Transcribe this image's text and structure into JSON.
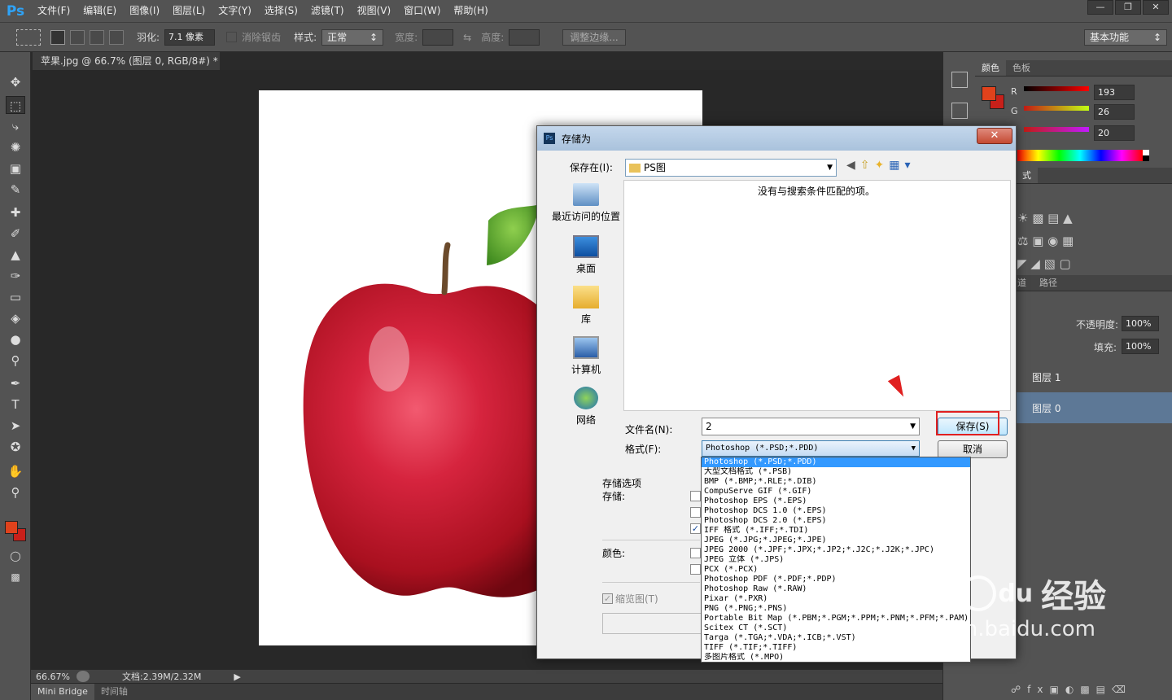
{
  "app": {
    "logo": "Ps"
  },
  "menu": [
    "文件(F)",
    "编辑(E)",
    "图像(I)",
    "图层(L)",
    "文字(Y)",
    "选择(S)",
    "滤镜(T)",
    "视图(V)",
    "窗口(W)",
    "帮助(H)"
  ],
  "options": {
    "feather_label": "羽化:",
    "feather_value": "7.1 像素",
    "antialias": "消除锯齿",
    "style_label": "样式:",
    "style_value": "正常",
    "width_label": "宽度:",
    "height_label": "高度:",
    "refine_button": "调整边缘...",
    "workspace": "基本功能"
  },
  "document": {
    "tab": "苹果.jpg @ 66.7% (图层 0, RGB/8#) *",
    "zoom": "66.67%",
    "docsize": "文档:2.39M/2.32M"
  },
  "bottom_tabs": [
    "Mini Bridge",
    "时间轴"
  ],
  "panels": {
    "color_tabs": [
      "颜色",
      "色板"
    ],
    "r_label": "R",
    "r_value": "193",
    "g_label": "G",
    "g_value": "26",
    "b_value": "20",
    "adj_tab_partial": "式",
    "layers_tabs": [
      "道",
      "路径"
    ],
    "opacity_label": "不透明度:",
    "opacity_value": "100%",
    "fill_label": "填充:",
    "fill_value": "100%",
    "layers": [
      "图层 1",
      "图层 0"
    ]
  },
  "dialog": {
    "title": "存储为",
    "savein_label": "保存在(I):",
    "savein_value": "PS图",
    "empty_msg": "没有与搜索条件匹配的项。",
    "places": [
      "最近访问的位置",
      "桌面",
      "库",
      "计算机",
      "网络"
    ],
    "filename_label": "文件名(N):",
    "filename_value": "2",
    "format_label": "格式(F):",
    "format_value": "Photoshop (*.PSD;*.PDD)",
    "save_button": "保存(S)",
    "cancel_button": "取消",
    "options_title": "存储选项",
    "save_label": "存储:",
    "color_label": "颜色:",
    "thumbnail_label": "缩览图(T)",
    "formats": [
      "Photoshop (*.PSD;*.PDD)",
      "大型文档格式 (*.PSB)",
      "BMP (*.BMP;*.RLE;*.DIB)",
      "CompuServe GIF (*.GIF)",
      "Photoshop EPS (*.EPS)",
      "Photoshop DCS 1.0 (*.EPS)",
      "Photoshop DCS 2.0 (*.EPS)",
      "IFF 格式 (*.IFF;*.TDI)",
      "JPEG (*.JPG;*.JPEG;*.JPE)",
      "JPEG 2000 (*.JPF;*.JPX;*.JP2;*.J2C;*.J2K;*.JPC)",
      "JPEG 立体 (*.JPS)",
      "PCX (*.PCX)",
      "Photoshop PDF (*.PDF;*.PDP)",
      "Photoshop Raw (*.RAW)",
      "Pixar (*.PXR)",
      "PNG (*.PNG;*.PNS)",
      "Portable Bit Map (*.PBM;*.PGM;*.PPM;*.PNM;*.PFM;*.PAM)",
      "Scitex CT (*.SCT)",
      "Targa (*.TGA;*.VDA;*.ICB;*.VST)",
      "TIFF (*.TIF;*.TIFF)",
      "多图片格式 (*.MPO)"
    ]
  },
  "watermark": {
    "brand": "Bai",
    "brand2": "du",
    "text": "经验",
    "url": "jingyan.baidu.com"
  },
  "colors": {
    "fg": "#e0421c",
    "bg": "#c8201a"
  }
}
